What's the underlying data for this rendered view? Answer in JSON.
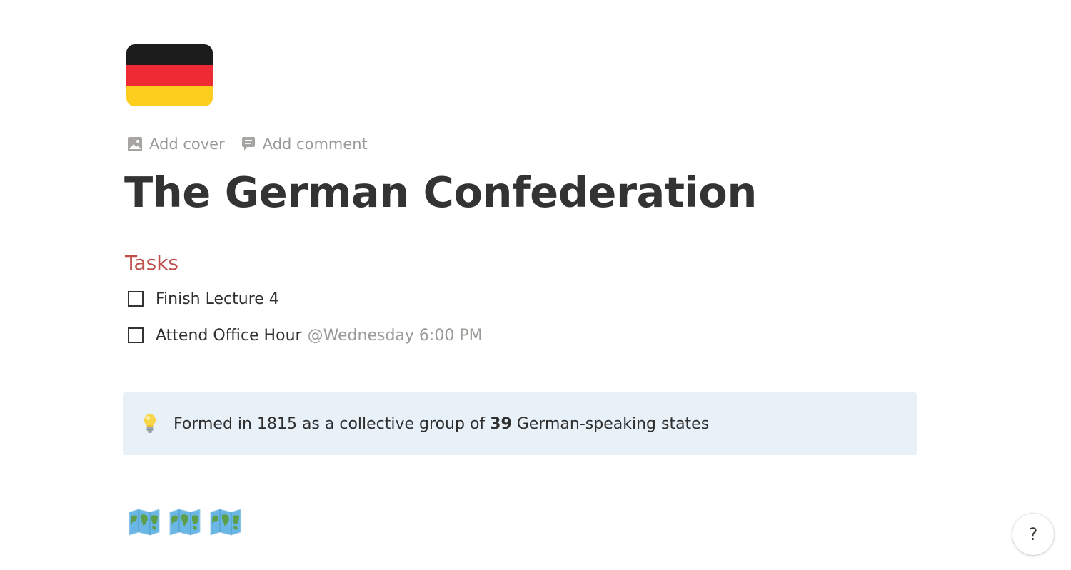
{
  "page": {
    "icon": "german-flag-icon",
    "icon_colors": [
      "#1c1c1c",
      "#ee2a35",
      "#fdce1e"
    ],
    "title": "The German Confederation"
  },
  "controls": {
    "add_cover": "Add cover",
    "add_comment": "Add comment"
  },
  "tasks": {
    "heading": "Tasks",
    "items": [
      {
        "label": "Finish Lecture 4",
        "checked": false,
        "mention": ""
      },
      {
        "label": "Attend Office Hour",
        "checked": false,
        "mention": "@Wednesday 6:00 PM"
      }
    ]
  },
  "callout": {
    "icon": "light-bulb-icon",
    "text_before": "Formed in 1815 as a collective group of ",
    "text_bold": "39",
    "text_after": " German-speaking states"
  },
  "maps": {
    "icon": "world-map-icon",
    "count": 3
  },
  "help": {
    "label": "?"
  },
  "colors": {
    "heading_red": "#c0504d",
    "callout_bg": "#e8f1f8",
    "muted_text": "#9b9a97"
  }
}
